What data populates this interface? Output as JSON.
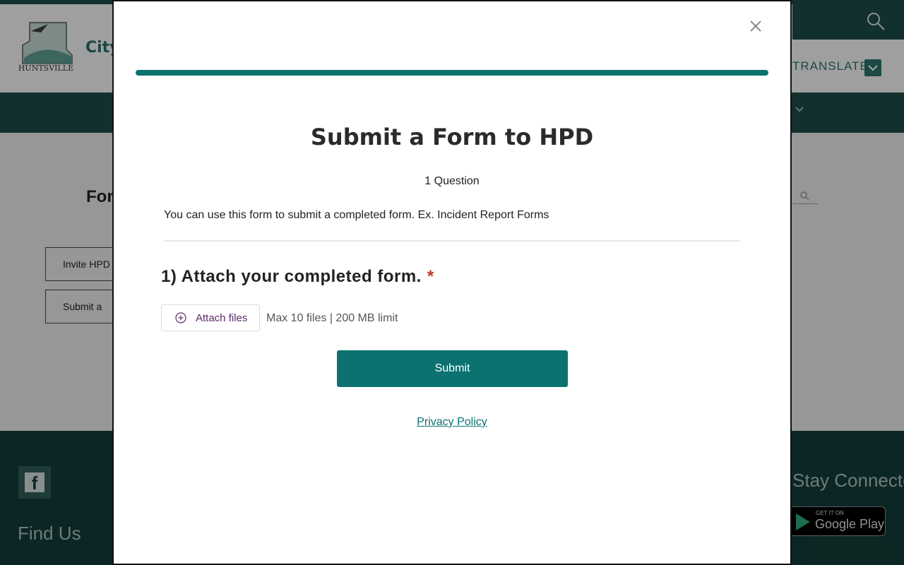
{
  "background": {
    "city_name": "City",
    "logo_text": "HUNTSVILLE",
    "translate_label": "TRANSLATE",
    "forms_title": "For",
    "buttons": [
      "Invite HPD",
      "Submit a"
    ],
    "footer": {
      "find_us": "Find Us",
      "stay_connected": "Stay Connected",
      "google_play_small": "GET IT ON",
      "google_play_big": "Google Play"
    }
  },
  "modal": {
    "title": "Submit a Form to HPD",
    "question_count": "1 Question",
    "description": "You can use this form to submit a completed form. Ex. Incident Report Forms",
    "question": {
      "label": "1) Attach your completed form.",
      "required_marker": "*"
    },
    "attach": {
      "label": "Attach files",
      "hint": "Max 10 files | 200 MB limit"
    },
    "submit_label": "Submit",
    "privacy_label": "Privacy Policy"
  },
  "colors": {
    "accent": "#0b7270",
    "header_dark": "#1c4a46",
    "footer": "#123b37",
    "required": "#c0392b"
  }
}
